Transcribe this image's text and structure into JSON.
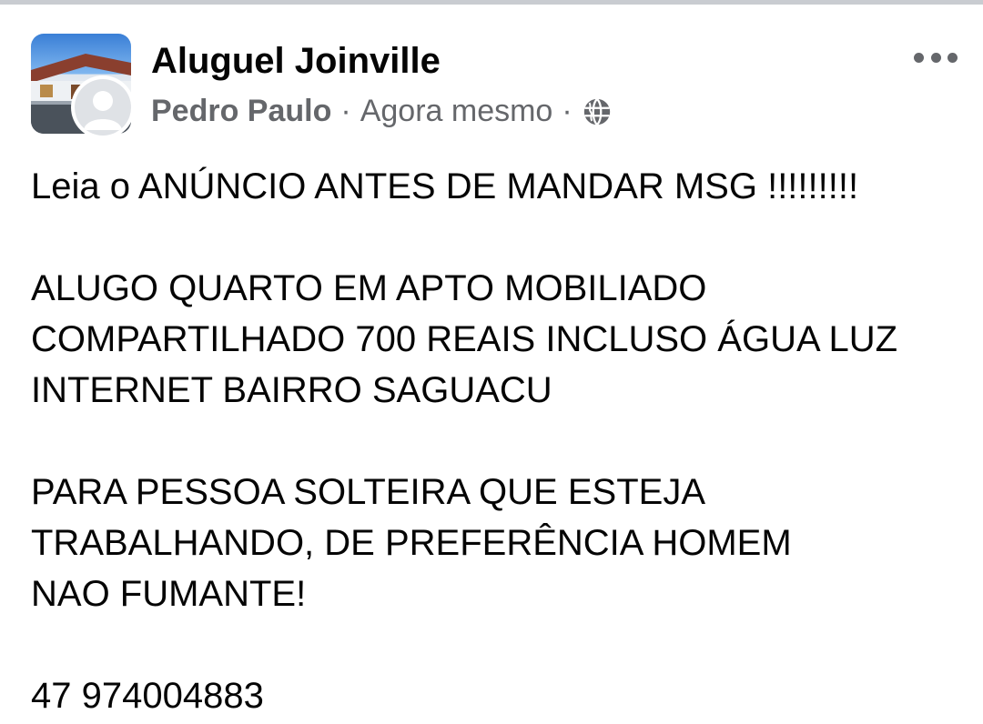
{
  "post": {
    "group_name": "Aluguel Joinville",
    "author": "Pedro Paulo",
    "separator": "·",
    "timestamp": "Agora mesmo",
    "privacy_icon": "globe-icon",
    "more_icon": "more-horizontal-icon",
    "lines": [
      "Leia o ANÚNCIO ANTES DE MANDAR MSG !!!!!!!!!",
      "ALUGO QUARTO EM APTO MOBILIADO",
      "COMPARTILHADO 700 REAIS INCLUSO ÁGUA LUZ",
      "INTERNET BAIRRO SAGUACU",
      "PARA PESSOA SOLTEIRA QUE ESTEJA",
      "TRABALHANDO, DE PREFERÊNCIA HOMEM",
      "NAO FUMANTE!",
      "47 974004883"
    ]
  },
  "colors": {
    "primary_text": "#050505",
    "secondary_text": "#65676b",
    "divider": "#c9ccd1"
  }
}
